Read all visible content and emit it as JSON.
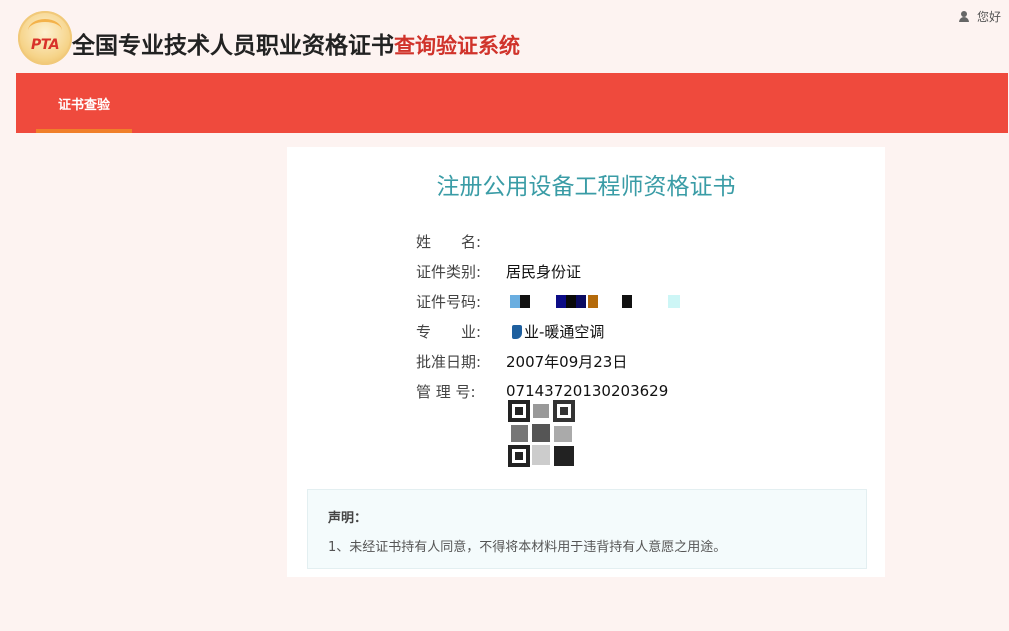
{
  "header": {
    "logo_text": "PTA",
    "title_main": "全国专业技术人员职业资格证书",
    "title_sub": "查询验证系统",
    "greeting": "您好"
  },
  "nav": {
    "tabs": [
      {
        "label": "证书查验",
        "active": true
      }
    ]
  },
  "certificate": {
    "title": "注册公用设备工程师资格证书",
    "fields": [
      {
        "label": "姓　　名:",
        "value": ""
      },
      {
        "label": "证件类别:",
        "value": "居民身份证"
      },
      {
        "label": "证件号码:",
        "value": ""
      },
      {
        "label": "专　　业:",
        "value": "业-暖通空调"
      },
      {
        "label": "批准日期:",
        "value": "2007年09月23日"
      },
      {
        "label": "管 理 号:",
        "value": "07143720130203629"
      }
    ]
  },
  "declaration": {
    "title": "声明：",
    "text": "1、未经证书持有人同意，不得将本材料用于违背持有人意愿之用途。"
  },
  "colors": {
    "nav_bg": "#ef4a3d",
    "tab_underline": "#f07f2a",
    "title_teal": "#3a9ca6",
    "brand_red": "#d0332b"
  }
}
